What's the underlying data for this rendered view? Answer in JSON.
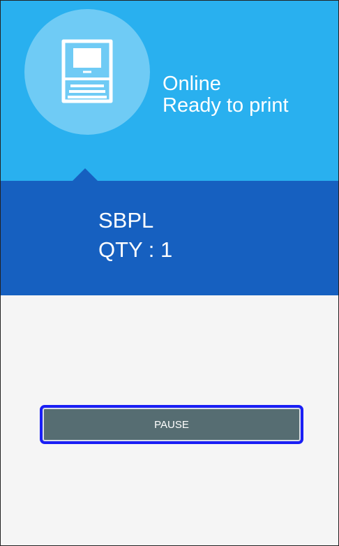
{
  "status": {
    "line1": "Online",
    "line2": "Ready to print",
    "icon": "printer-icon"
  },
  "job": {
    "name": "SBPL",
    "quantity": "QTY : 1"
  },
  "actions": {
    "pause_label": "PAUSE"
  },
  "colors": {
    "status_bg": "#29b0ef",
    "job_bg": "#1660c0",
    "content_bg": "#f5f5f5",
    "button_bg": "#566d72",
    "focus_ring": "#1a1ff5"
  }
}
